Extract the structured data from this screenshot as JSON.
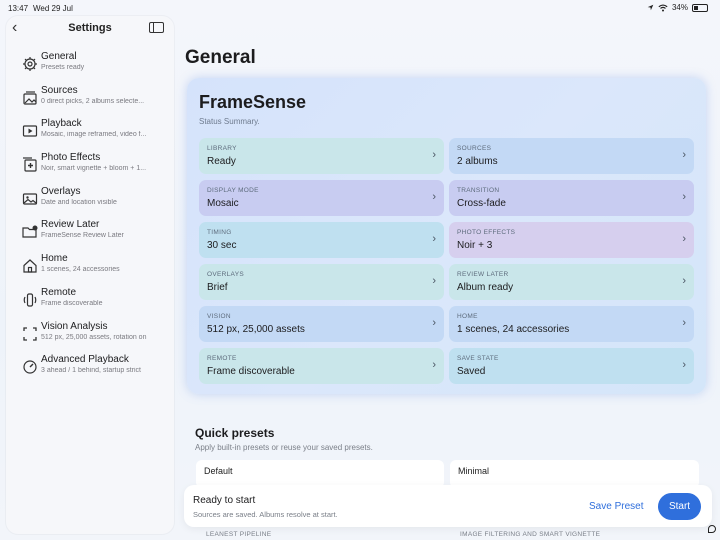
{
  "status_bar": {
    "time": "13:47",
    "date": "Wed 29 Jul",
    "battery": "34%"
  },
  "sidebar": {
    "title": "Settings",
    "items": [
      {
        "label": "General",
        "sub": "Presets ready",
        "icon": "gear-icon"
      },
      {
        "label": "Sources",
        "sub": "0 direct picks, 2 albums selecte...",
        "icon": "photo-stack-icon"
      },
      {
        "label": "Playback",
        "sub": "Mosaic, image reframed, video f...",
        "icon": "play-rectangle-icon"
      },
      {
        "label": "Photo Effects",
        "sub": "Noir, smart vignette + bloom + 1...",
        "icon": "effects-plus-icon"
      },
      {
        "label": "Overlays",
        "sub": "Date and location visible",
        "icon": "photo-icon"
      },
      {
        "label": "Review Later",
        "sub": "FrameSense Review Later",
        "icon": "folder-badge-icon"
      },
      {
        "label": "Home",
        "sub": "1 scenes, 24 accessories",
        "icon": "house-icon"
      },
      {
        "label": "Remote",
        "sub": "Frame discoverable",
        "icon": "remote-icon"
      },
      {
        "label": "Vision Analysis",
        "sub": "512 px, 25,000 assets, rotation on",
        "icon": "viewfinder-icon"
      },
      {
        "label": "Advanced Playback",
        "sub": "3 ahead / 1 behind, startup strict",
        "icon": "gauge-icon"
      }
    ]
  },
  "main": {
    "title": "General",
    "card": {
      "title": "FrameSense",
      "subtitle": "Status Summary.",
      "tiles": [
        {
          "label": "LIBRARY",
          "value": "Ready"
        },
        {
          "label": "SOURCES",
          "value": "2 albums"
        },
        {
          "label": "DISPLAY MODE",
          "value": "Mosaic"
        },
        {
          "label": "TRANSITION",
          "value": "Cross-fade"
        },
        {
          "label": "TIMING",
          "value": "30 sec"
        },
        {
          "label": "PHOTO EFFECTS",
          "value": "Noir + 3"
        },
        {
          "label": "OVERLAYS",
          "value": "Brief"
        },
        {
          "label": "REVIEW LATER",
          "value": "Album ready"
        },
        {
          "label": "VISION",
          "value": "512 px, 25,000 assets"
        },
        {
          "label": "HOME",
          "value": "1 scenes, 24 accessories"
        },
        {
          "label": "REMOTE",
          "value": "Frame discoverable"
        },
        {
          "label": "SAVE STATE",
          "value": "Saved"
        }
      ]
    },
    "quick_presets": {
      "title": "Quick presets",
      "subtitle": "Apply built-in presets or reuse your saved presets.",
      "presets": [
        {
          "name": "Default"
        },
        {
          "name": "Minimal"
        }
      ],
      "bottom_tags": [
        "LEANEST PIPELINE",
        "IMAGE FILTERING AND SMART VIGNETTE"
      ]
    }
  },
  "footer": {
    "title": "Ready to start",
    "subtitle": "Sources are saved. Albums resolve at start.",
    "save_label": "Save Preset",
    "start_label": "Start",
    "accent": "#2f6fdc"
  }
}
